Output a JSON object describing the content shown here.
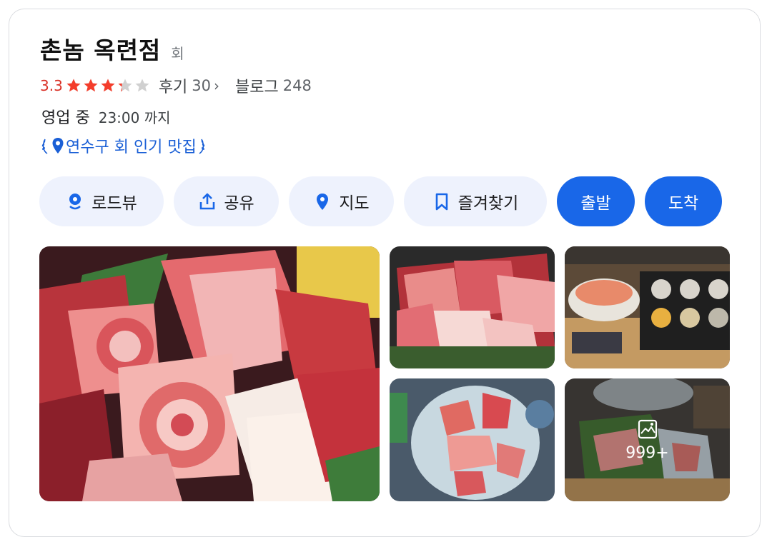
{
  "place": {
    "name": "촌놈 옥련점",
    "category": "회"
  },
  "rating": {
    "value": "3.3",
    "stars_filled_fraction": 0.66,
    "star_color": "#f43d2b",
    "reviews_label": "후기",
    "reviews_count": "30",
    "blog_label": "블로그",
    "blog_count": "248"
  },
  "status": {
    "open_label": "영업 중",
    "hours": "23:00 까지"
  },
  "badge": {
    "text": "연수구 회 인기 맛집"
  },
  "actions": [
    {
      "label": "로드뷰",
      "icon": "roadview-icon"
    },
    {
      "label": "공유",
      "icon": "share-icon"
    },
    {
      "label": "지도",
      "icon": "map-pin-icon"
    },
    {
      "label": "즐겨찾기",
      "icon": "bookmark-icon"
    },
    {
      "label": "출발",
      "icon": ""
    },
    {
      "label": "도착",
      "icon": ""
    }
  ],
  "photos": {
    "more_count": "999+"
  },
  "colors": {
    "accent": "#1967e8",
    "chip_bg": "#eef2fd",
    "badge_text": "#1a5fd6",
    "rating_red": "#d93025"
  }
}
